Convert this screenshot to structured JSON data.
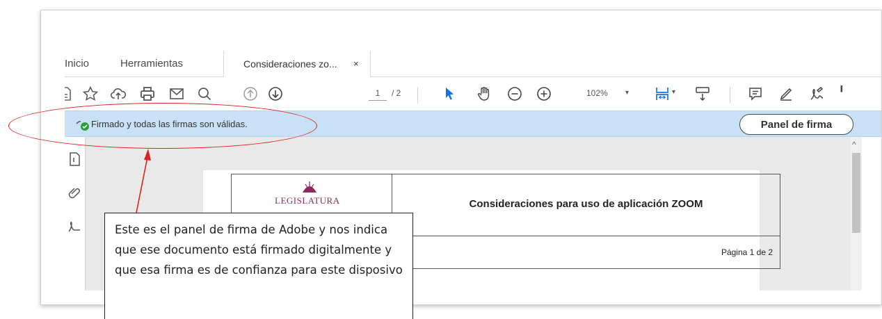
{
  "tabs": {
    "inicio": "Inicio",
    "herramientas": "Herramientas",
    "document": "Consideraciones zo...",
    "close": "×"
  },
  "toolbar": {
    "page_current": "1",
    "page_total": "/ 2",
    "zoom": "102%",
    "zoom_caret": "▾",
    "icons": [
      "save-icon",
      "bookmark-star-icon",
      "upload-cloud-icon",
      "print-icon",
      "email-icon",
      "find-icon",
      "page-up-icon",
      "page-down-icon",
      "select-pointer-icon",
      "hand-icon",
      "zoom-out-icon",
      "zoom-in-icon",
      "fit-page-icon",
      "scroll-mode-icon",
      "comment-icon",
      "highlight-icon",
      "sign-icon"
    ]
  },
  "signature_bar": {
    "message": "Firmado y todas las firmas son válidas.",
    "panel_button": "Panel de firma",
    "status_color": "#2e9e3a"
  },
  "document": {
    "logo_text": "LEGISLATURA",
    "title": "Consideraciones para uso de aplicación ZOOM",
    "page_label": "Página 1 de 2"
  },
  "annotation": {
    "callout_text": "Este es el panel de firma de Adobe y nos indica que ese documento está firmado digitalmente y que esa firma es de confianza para este disposivo",
    "color": "#e02020"
  }
}
